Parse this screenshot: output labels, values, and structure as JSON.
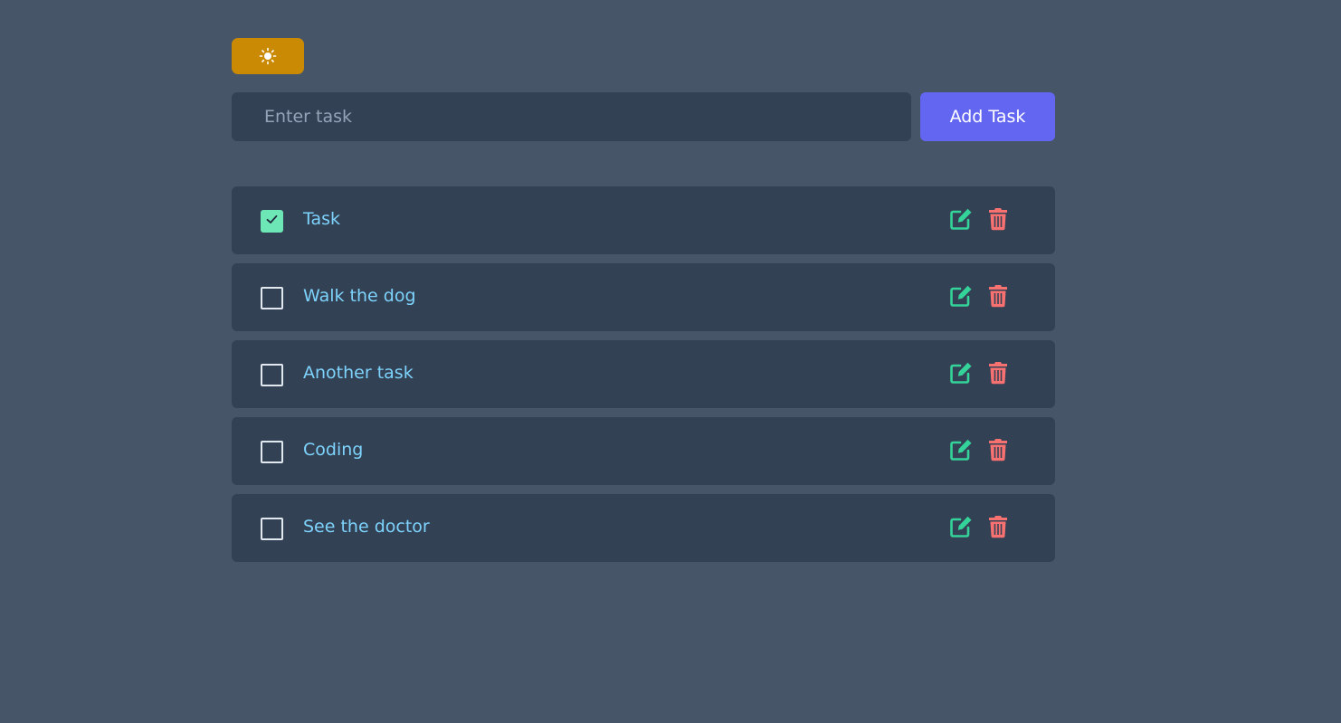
{
  "theme_toggle": {
    "icon": "sun-icon",
    "color": "#ca8a04"
  },
  "add_task": {
    "input_placeholder": "Enter task",
    "input_value": "",
    "button_label": "Add Task",
    "button_color": "#6366f1"
  },
  "tasks": [
    {
      "label": "Task",
      "completed": true
    },
    {
      "label": "Walk the dog",
      "completed": false
    },
    {
      "label": "Another task",
      "completed": false
    },
    {
      "label": "Coding",
      "completed": false
    },
    {
      "label": "See the doctor",
      "completed": false
    }
  ],
  "icons": {
    "edit": "edit-icon",
    "delete": "trash-icon",
    "edit_color": "#34d399",
    "delete_color": "#f87171"
  }
}
